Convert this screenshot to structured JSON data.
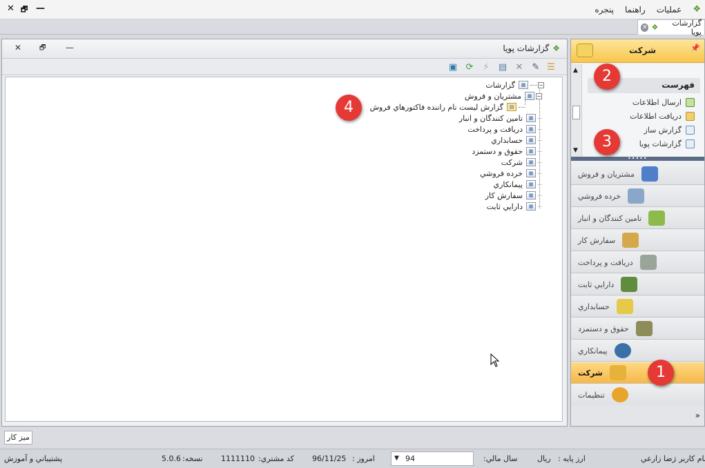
{
  "menubar": {
    "items": [
      "عمليات",
      "راهنما",
      "پنجره"
    ],
    "controls": {
      "close": "✕",
      "restore": "🗗",
      "minimize": "—"
    }
  },
  "tabs": {
    "doc_tab_label": "گزارشات پويا"
  },
  "report_window": {
    "title": "گزارشات پويا",
    "controls": {
      "close": "✕",
      "restore": "🗗",
      "minimize": "—"
    },
    "tree": {
      "root": "گزارشات",
      "first_group": "مشتريان و فروش",
      "first_child": "گزارش ليست نام راننده فاكتورهاي فروش",
      "groups": [
        "تامين كنندگان و انبار",
        "دريافت و پرداخت",
        "حسابداري",
        "حقوق و دستمزد",
        "شركت",
        "خرده فروشي",
        "پيمانكاري",
        "سفارش كار",
        "دارايي ثابت"
      ]
    }
  },
  "nav": {
    "header_title": "شركت",
    "group_title": "فهرست",
    "sub_items": [
      "ارسال اطلاعات",
      "دريافت اطلاعات",
      "گزارش ساز",
      "گزارشات پويا"
    ],
    "buttons": [
      {
        "label": "مشتريان و فروش",
        "icon": "chart-icon",
        "color": "#4e7fc8"
      },
      {
        "label": "خرده فروشي",
        "icon": "cart-icon",
        "color": "#8aa7c9"
      },
      {
        "label": "تامين كنندگان و انبار",
        "icon": "boxes-icon",
        "color": "#8dbb4b"
      },
      {
        "label": "سفارش كار",
        "icon": "order-icon",
        "color": "#d5a94b"
      },
      {
        "label": "دريافت و پرداخت",
        "icon": "payment-icon",
        "color": "#9aa59a"
      },
      {
        "label": "دارايي ثابت",
        "icon": "assets-icon",
        "color": "#5f8c3d"
      },
      {
        "label": "حسابداري",
        "icon": "accounting-icon",
        "color": "#e7c94a"
      },
      {
        "label": "حقوق و دستمزد",
        "icon": "salary-icon",
        "color": "#8d8d5a"
      },
      {
        "label": "پيمانكاري",
        "icon": "contract-icon",
        "color": "#3b6fa8"
      },
      {
        "label": "شركت",
        "icon": "company-icon",
        "color": "#e6b23a",
        "active": true
      },
      {
        "label": "تنظيمات",
        "icon": "settings-gear-icon",
        "color": "#e8a52b"
      }
    ],
    "footer_chevron": "»"
  },
  "deskbar": {
    "desk_button": "ميز كار"
  },
  "statusbar": {
    "support": "پشتيباني و آموزش",
    "version_label": "نسخه:",
    "version": "5.0.6",
    "customer_code_label": "كد مشتري:",
    "customer_code": "1111110",
    "today_label": "امروز :",
    "today": "96/11/25",
    "fiscal_year_label": "سال مالي:",
    "fiscal_year": "94",
    "base_currency_label": "ارز پايه :",
    "base_currency": "ريال",
    "user_label": "نام كاربر :",
    "user": "رضا زارعي"
  },
  "callouts": [
    "1",
    "2",
    "3",
    "4"
  ]
}
